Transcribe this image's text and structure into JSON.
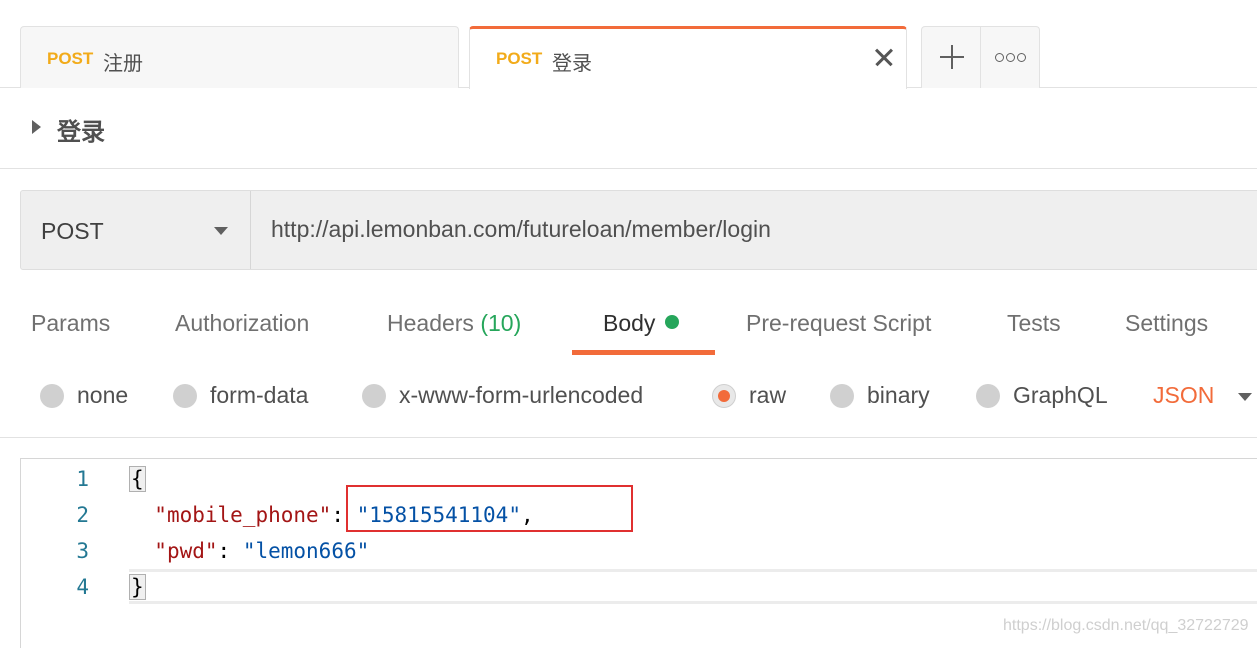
{
  "tabs": [
    {
      "method": "POST",
      "name": "注册",
      "active": false
    },
    {
      "method": "POST",
      "name": "登录",
      "active": true
    }
  ],
  "request": {
    "name": "登录",
    "method": "POST",
    "url": "http://api.lemonban.com/futureloan/member/login"
  },
  "request_tabs": {
    "params": "Params",
    "authorization": "Authorization",
    "headers": "Headers",
    "headers_count": "(10)",
    "body": "Body",
    "prerequest": "Pre-request Script",
    "tests": "Tests",
    "settings": "Settings"
  },
  "body_types": {
    "none": "none",
    "form_data": "form-data",
    "urlencoded": "x-www-form-urlencoded",
    "raw": "raw",
    "binary": "binary",
    "graphql": "GraphQL",
    "selected": "raw",
    "format": "JSON"
  },
  "editor": {
    "lines": [
      {
        "num": "1",
        "open": "{"
      },
      {
        "num": "2",
        "key": "\"mobile_phone\"",
        "sep": ": ",
        "value": "\"15815541104\"",
        "tail": ","
      },
      {
        "num": "3",
        "key": "\"pwd\"",
        "sep": ": ",
        "value": "\"lemon666\"",
        "tail": ""
      },
      {
        "num": "4",
        "close": "}"
      }
    ]
  },
  "watermark": "https://blog.csdn.net/qq_32722729",
  "colors": {
    "accent": "#f26b3a",
    "method_post": "#f2ab1a",
    "success": "#26a65b",
    "json_key": "#a31515",
    "json_string": "#0451a5",
    "highlight_box": "#e03030"
  }
}
